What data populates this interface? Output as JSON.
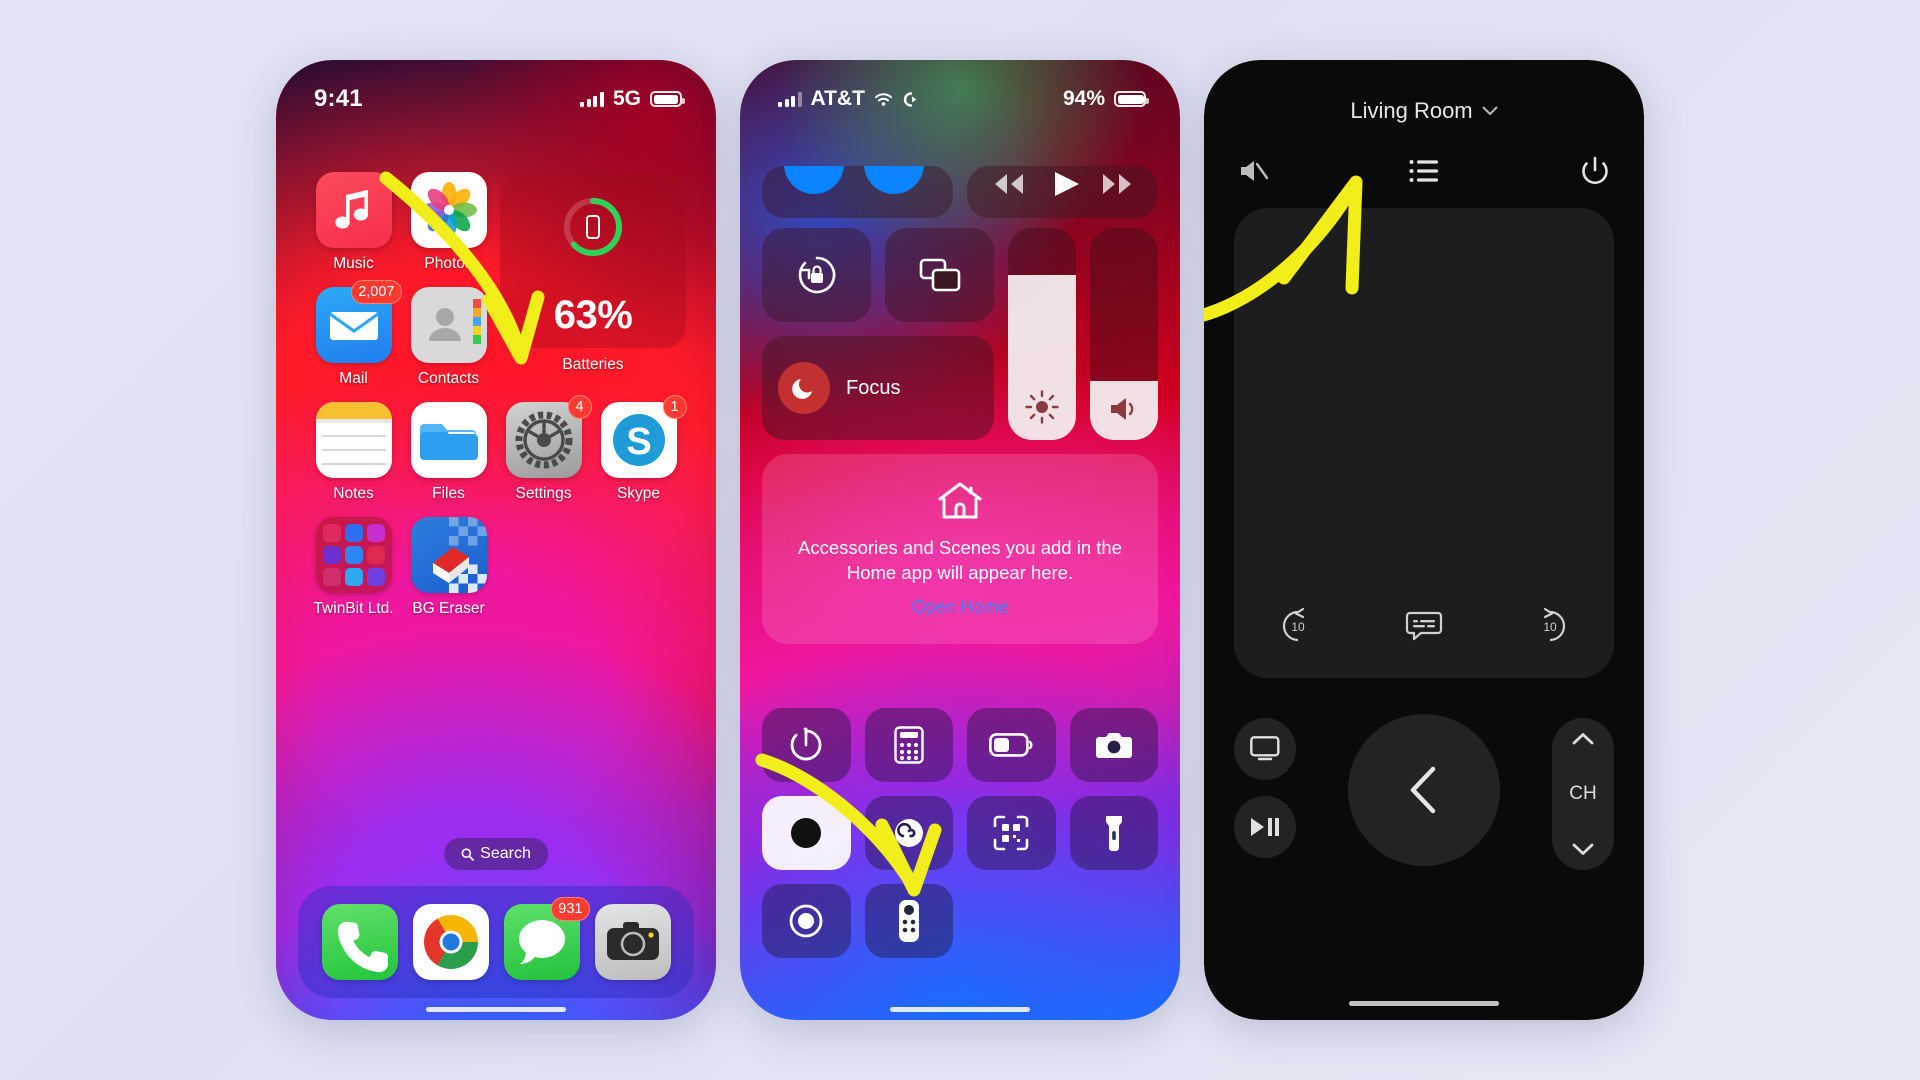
{
  "page": {
    "background": "#e3e4f3",
    "accent_arrow_color": "#f2ee1a"
  },
  "phone1": {
    "status": {
      "time": "9:41",
      "network": "5G",
      "signal_icon": "cellular-bars-icon",
      "battery_icon": "battery-full-icon"
    },
    "apps": [
      {
        "name": "Music",
        "icon": "music-note-icon",
        "badge": ""
      },
      {
        "name": "Photos",
        "icon": "photos-flower-icon",
        "badge": ""
      },
      {
        "name": "Mail",
        "icon": "mail-envelope-icon",
        "badge": "2,007"
      },
      {
        "name": "Contacts",
        "icon": "contacts-person-icon",
        "badge": ""
      },
      {
        "name": "Notes",
        "icon": "notes-paper-icon",
        "badge": ""
      },
      {
        "name": "Files",
        "icon": "files-folder-icon",
        "badge": ""
      },
      {
        "name": "Settings",
        "icon": "settings-gear-icon",
        "badge": "4"
      },
      {
        "name": "Skype",
        "icon": "skype-s-icon",
        "badge": "1"
      },
      {
        "name": "TwinBit Ltd.",
        "icon": "app-folder-icon",
        "badge": ""
      },
      {
        "name": "BG Eraser",
        "icon": "bg-eraser-icon",
        "badge": ""
      }
    ],
    "widget": {
      "title": "Batteries",
      "percent": "63%",
      "ring_value": 63,
      "ring_color": "#30d158",
      "device_icon": "iphone-icon"
    },
    "search": {
      "label": "Search",
      "icon": "search-icon"
    },
    "dock": [
      {
        "name": "Phone",
        "icon": "phone-handset-icon",
        "badge": ""
      },
      {
        "name": "Chrome",
        "icon": "chrome-icon",
        "badge": ""
      },
      {
        "name": "Messages",
        "icon": "messages-bubble-icon",
        "badge": "931"
      },
      {
        "name": "Camera",
        "icon": "camera-icon",
        "badge": ""
      }
    ]
  },
  "phone2": {
    "status": {
      "carrier": "AT&T",
      "battery_percent": "94%",
      "wifi_icon": "wifi-icon",
      "vpn_icon": "vpn-icon",
      "signal_icon": "cellular-bars-icon"
    },
    "toggles": [
      {
        "name": "Rotation Lock",
        "icon": "rotation-lock-icon",
        "state": "off"
      },
      {
        "name": "Screen Mirroring",
        "icon": "screen-mirroring-icon",
        "state": "off"
      },
      {
        "name": "Focus",
        "icon": "moon-icon",
        "state": "off",
        "label": "Focus"
      }
    ],
    "sliders": [
      {
        "name": "Brightness",
        "icon": "brightness-sun-icon",
        "value": 78
      },
      {
        "name": "Volume",
        "icon": "volume-speaker-icon",
        "value": 28
      }
    ],
    "home_card": {
      "icon": "home-house-icon",
      "message": "Accessories and Scenes you add in the Home app will appear here.",
      "open_label": "Open Home"
    },
    "buttons": [
      {
        "name": "Timer",
        "icon": "timer-icon",
        "state": "off"
      },
      {
        "name": "Calculator",
        "icon": "calculator-icon",
        "state": "off"
      },
      {
        "name": "Low Power Mode",
        "icon": "low-power-battery-icon",
        "state": "off"
      },
      {
        "name": "Camera",
        "icon": "camera-icon",
        "state": "off"
      },
      {
        "name": "Dark Mode",
        "icon": "dark-mode-icon",
        "state": "on"
      },
      {
        "name": "Hearing",
        "icon": "hearing-ear-icon",
        "state": "off"
      },
      {
        "name": "Code Scanner",
        "icon": "qr-scanner-icon",
        "state": "off"
      },
      {
        "name": "Flashlight",
        "icon": "flashlight-icon",
        "state": "off"
      },
      {
        "name": "Screen Recording",
        "icon": "screen-record-icon",
        "state": "off"
      },
      {
        "name": "Apple TV Remote",
        "icon": "tv-remote-icon",
        "state": "off"
      }
    ]
  },
  "phone3": {
    "title": "Living Room",
    "title_chevron_icon": "chevron-down-icon",
    "toolbar": [
      {
        "name": "Mute",
        "icon": "mute-speaker-icon"
      },
      {
        "name": "Menu",
        "icon": "list-menu-icon"
      },
      {
        "name": "Power",
        "icon": "power-icon"
      }
    ],
    "touchpad": {
      "name": "touchpad"
    },
    "media": [
      {
        "name": "Skip Back 10",
        "icon": "rewind-10-icon",
        "label": "10"
      },
      {
        "name": "Subtitles",
        "icon": "subtitles-icon"
      },
      {
        "name": "Skip Forward 10",
        "icon": "forward-10-icon",
        "label": "10"
      }
    ],
    "lower": [
      {
        "name": "TV App",
        "icon": "tv-screen-icon"
      },
      {
        "name": "Play Pause",
        "icon": "play-pause-icon"
      },
      {
        "name": "Back",
        "icon": "back-chevron-icon"
      }
    ],
    "channel": {
      "up_icon": "chevron-up-icon",
      "label": "CH",
      "down_icon": "chevron-down-icon"
    }
  }
}
